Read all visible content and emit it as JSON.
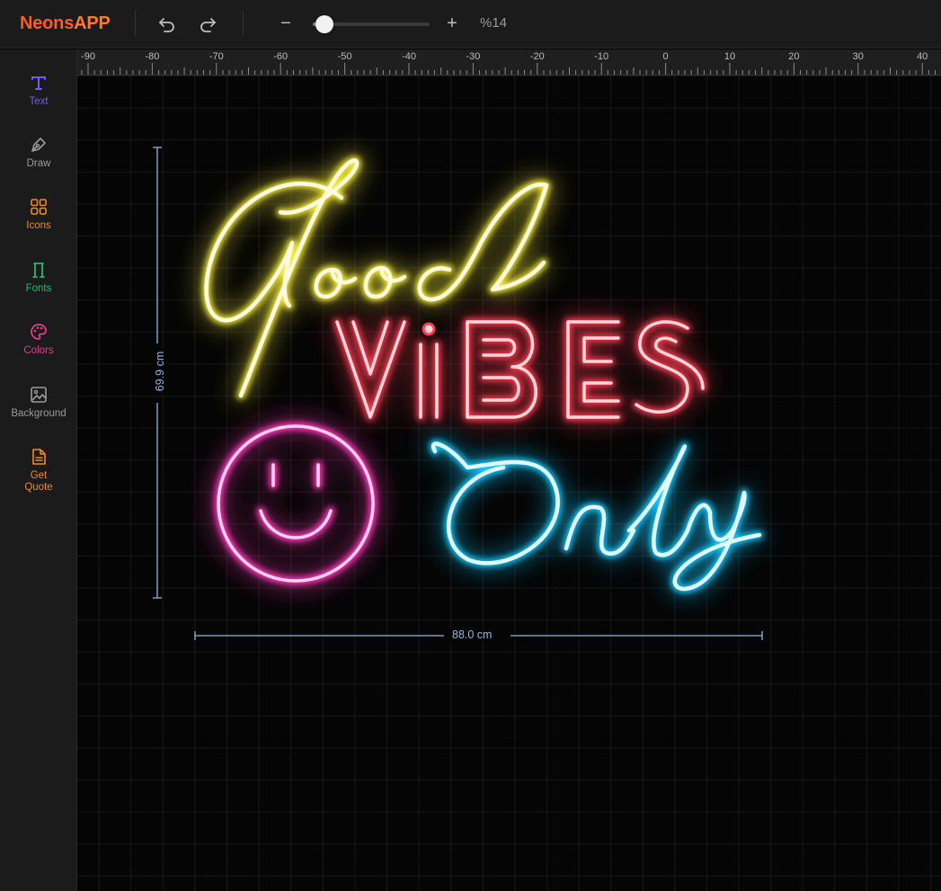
{
  "app": {
    "logo_part1": "Neons",
    "logo_part2": "APP",
    "logo_color": "#ff5a1f"
  },
  "toolbar": {
    "undo_icon": "undo-icon",
    "redo_icon": "redo-icon",
    "zoom_minus": "−",
    "zoom_plus": "+",
    "zoom_value": "%14",
    "zoom_level": 0.05
  },
  "sidebar": {
    "items": [
      {
        "label": "Text",
        "icon": "text-icon",
        "color": "#6d5df7"
      },
      {
        "label": "Draw",
        "icon": "pen-icon",
        "color": "#9a9a9a"
      },
      {
        "label": "Icons",
        "icon": "grid-icon",
        "color": "#f08a24"
      },
      {
        "label": "Fonts",
        "icon": "font-icon",
        "color": "#2bb673"
      },
      {
        "label": "Colors",
        "icon": "palette-icon",
        "color": "#e63b8f"
      },
      {
        "label": "Background",
        "icon": "image-icon",
        "color": "#9a9a9a"
      },
      {
        "label": "Get Quote",
        "icon": "document-icon",
        "color": "#f08a24"
      }
    ]
  },
  "ruler": {
    "labels": [
      "-90",
      "-80",
      "-70",
      "-60",
      "-50",
      "-40",
      "-30",
      "-20",
      "-10",
      "0",
      "10",
      "20",
      "30",
      "40"
    ]
  },
  "design": {
    "lines": [
      {
        "text": "Good",
        "color": "#f5ea3a"
      },
      {
        "text": "ViBES",
        "color": "#ff3b4f"
      },
      {
        "text": "Only",
        "color": "#18c8ff"
      }
    ],
    "smiley_color": "#ff38b8",
    "height_label": "69.9 cm",
    "width_label": "88.0 cm",
    "dimension_color": "#8fb7e6"
  }
}
